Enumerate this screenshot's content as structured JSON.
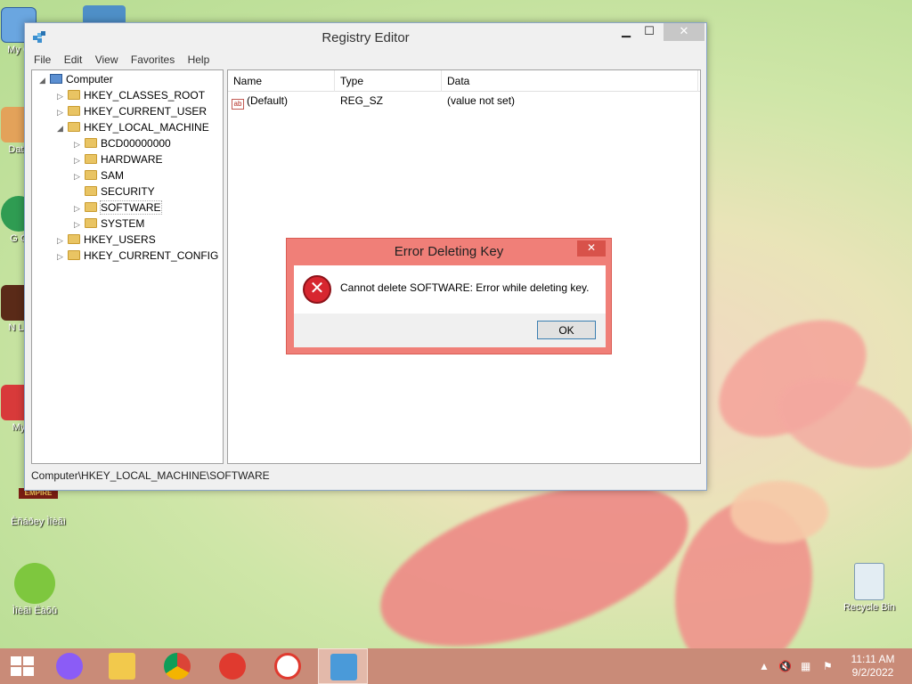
{
  "desktop": {
    "icons": [
      {
        "label": "My C",
        "name": "my-computer"
      },
      {
        "label": "Data",
        "name": "data"
      },
      {
        "label": "G\nC",
        "name": "google-chrome"
      },
      {
        "label": "N\nLa",
        "name": "n-la"
      },
      {
        "label": "My",
        "name": "my-documents"
      },
      {
        "label": "Èñáðey Ìîèãì",
        "name": "empire-game"
      },
      {
        "label": "Ìîèãì Ëàõû",
        "name": "game-controller"
      },
      {
        "label": "Recycle Bin",
        "name": "recycle-bin"
      }
    ],
    "empire_logo_text": "EMPIRE"
  },
  "window": {
    "title": "Registry Editor",
    "menu": [
      "File",
      "Edit",
      "View",
      "Favorites",
      "Help"
    ],
    "tree": {
      "root": "Computer",
      "items": [
        "HKEY_CLASSES_ROOT",
        "HKEY_CURRENT_USER",
        "HKEY_LOCAL_MACHINE",
        "BCD00000000",
        "HARDWARE",
        "SAM",
        "SECURITY",
        "SOFTWARE",
        "SYSTEM",
        "HKEY_USERS",
        "HKEY_CURRENT_CONFIG"
      ]
    },
    "list": {
      "columns": [
        "Name",
        "Type",
        "Data"
      ],
      "rows": [
        {
          "name": "(Default)",
          "type": "REG_SZ",
          "data": "(value not set)"
        }
      ]
    },
    "status": "Computer\\HKEY_LOCAL_MACHINE\\SOFTWARE"
  },
  "dialog": {
    "title": "Error Deleting Key",
    "message": "Cannot delete SOFTWARE:  Error while deleting key.",
    "ok_label": "OK",
    "close_glyph": "✕"
  },
  "taskbar": {
    "time": "11:11 AM",
    "date": "9/2/2022"
  },
  "colors": {
    "dialog_frame": "#f07f78",
    "taskbar": "#c98b78"
  }
}
